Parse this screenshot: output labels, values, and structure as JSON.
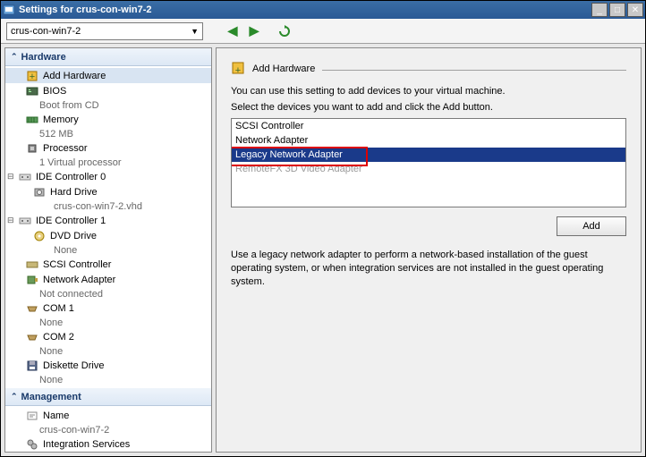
{
  "window": {
    "title": "Settings for crus-con-win7-2"
  },
  "toolbar": {
    "vm_name": "crus-con-win7-2"
  },
  "sections": {
    "hardware": "Hardware",
    "management": "Management"
  },
  "tree": {
    "add_hardware": "Add Hardware",
    "bios": "BIOS",
    "bios_sub": "Boot from CD",
    "memory": "Memory",
    "memory_sub": "512 MB",
    "processor": "Processor",
    "processor_sub": "1 Virtual processor",
    "ide0": "IDE Controller 0",
    "hard_drive": "Hard Drive",
    "hard_drive_sub": "crus-con-win7-2.vhd",
    "ide1": "IDE Controller 1",
    "dvd": "DVD Drive",
    "dvd_sub": "None",
    "scsi": "SCSI Controller",
    "nic": "Network Adapter",
    "nic_sub": "Not connected",
    "com1": "COM 1",
    "com1_sub": "None",
    "com2": "COM 2",
    "com2_sub": "None",
    "diskette": "Diskette Drive",
    "diskette_sub": "None",
    "name": "Name",
    "name_sub": "crus-con-win7-2",
    "integration": "Integration Services"
  },
  "right": {
    "title": "Add Hardware",
    "desc1": "You can use this setting to add devices to your virtual machine.",
    "desc2": "Select the devices you want to add and click the Add button.",
    "items": {
      "scsi": "SCSI Controller",
      "nic": "Network Adapter",
      "legacy": "Legacy Network Adapter",
      "remotefx": "RemoteFX 3D Video Adapter"
    },
    "add_btn": "Add",
    "info": "Use a legacy network adapter to perform a network-based installation of the guest operating system, or when integration services are not installed in the guest operating system."
  }
}
